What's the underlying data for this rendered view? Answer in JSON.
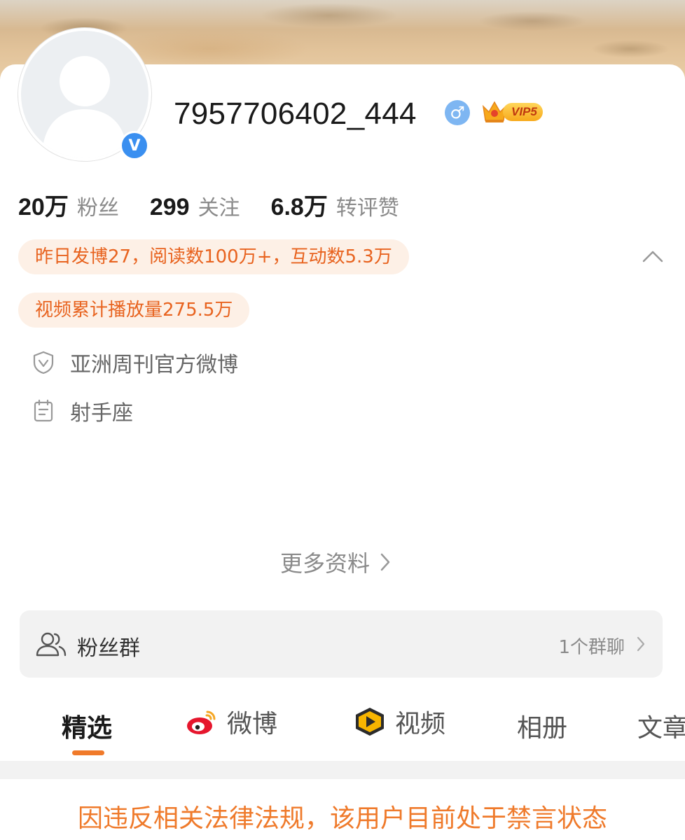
{
  "profile": {
    "username": "7957706402_444",
    "gender_symbol": "♂",
    "verified_mark": "V",
    "vip_label": "VIP5"
  },
  "stats": [
    {
      "value": "20万",
      "label": "粉丝"
    },
    {
      "value": "299",
      "label": "关注"
    },
    {
      "value": "6.8万",
      "label": "转评赞"
    }
  ],
  "highlights": {
    "activity": "昨日发博27，阅读数100万+，互动数5.3万",
    "video_plays": "视频累计播放量275.5万"
  },
  "info": {
    "verification": "亚洲周刊官方微博",
    "zodiac": "射手座"
  },
  "more_info_label": "更多资料",
  "fans_group": {
    "title": "粉丝群",
    "count": "1个群聊"
  },
  "tabs": [
    {
      "label": "精选",
      "icon": "none",
      "active": true
    },
    {
      "label": "微博",
      "icon": "weibo-logo-icon",
      "active": false
    },
    {
      "label": "视频",
      "icon": "video-play-icon",
      "active": false
    },
    {
      "label": "相册",
      "icon": "none",
      "active": false
    },
    {
      "label": "文章",
      "icon": "none",
      "active": false
    }
  ],
  "notice": "因违反相关法律法规，该用户目前处于禁言状态",
  "colors": {
    "accent": "#EF7A2B",
    "pill_bg": "#FDF0E6",
    "verified_blue": "#3A8FF0",
    "vip_gold": "#F7A91B"
  }
}
